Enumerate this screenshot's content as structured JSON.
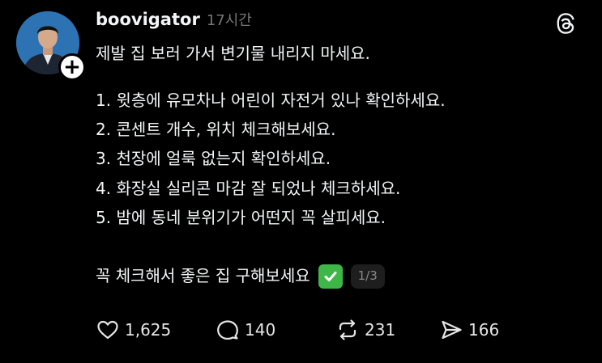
{
  "post": {
    "username": "boovigator",
    "timestamp": "17시간",
    "intro": "제발 집 보러 가서 변기물 내리지 마세요.",
    "checklist": [
      "1. 윗층에 유모차나 어린이 자전거 있나 확인하세요.",
      "2. 콘센트 개수, 위치 체크해보세요.",
      "3. 천장에 얼룩 없는지 확인하세요.",
      "4. 화장실 실리콘 마감 잘 되었나 체크하세요.",
      "5. 밤에 동네 분위기가 어떤지 꼭 살피세요."
    ],
    "outro": "꼭 체크해서 좋은 집 구해보세요",
    "page_indicator": "1/3"
  },
  "actions": {
    "likes": "1,625",
    "replies": "140",
    "reposts": "231",
    "shares": "166"
  },
  "icons": {
    "avatar": "avatar",
    "follow": "plus-icon",
    "brand": "threads-logo-icon",
    "check": "check-mark-emoji-icon",
    "like": "heart-icon",
    "reply": "comment-bubble-icon",
    "repost": "repost-icon",
    "share": "send-icon"
  },
  "colors": {
    "background": "#000000",
    "text": "#f3f5f7",
    "muted": "#777777",
    "check_green": "#3fb648"
  }
}
